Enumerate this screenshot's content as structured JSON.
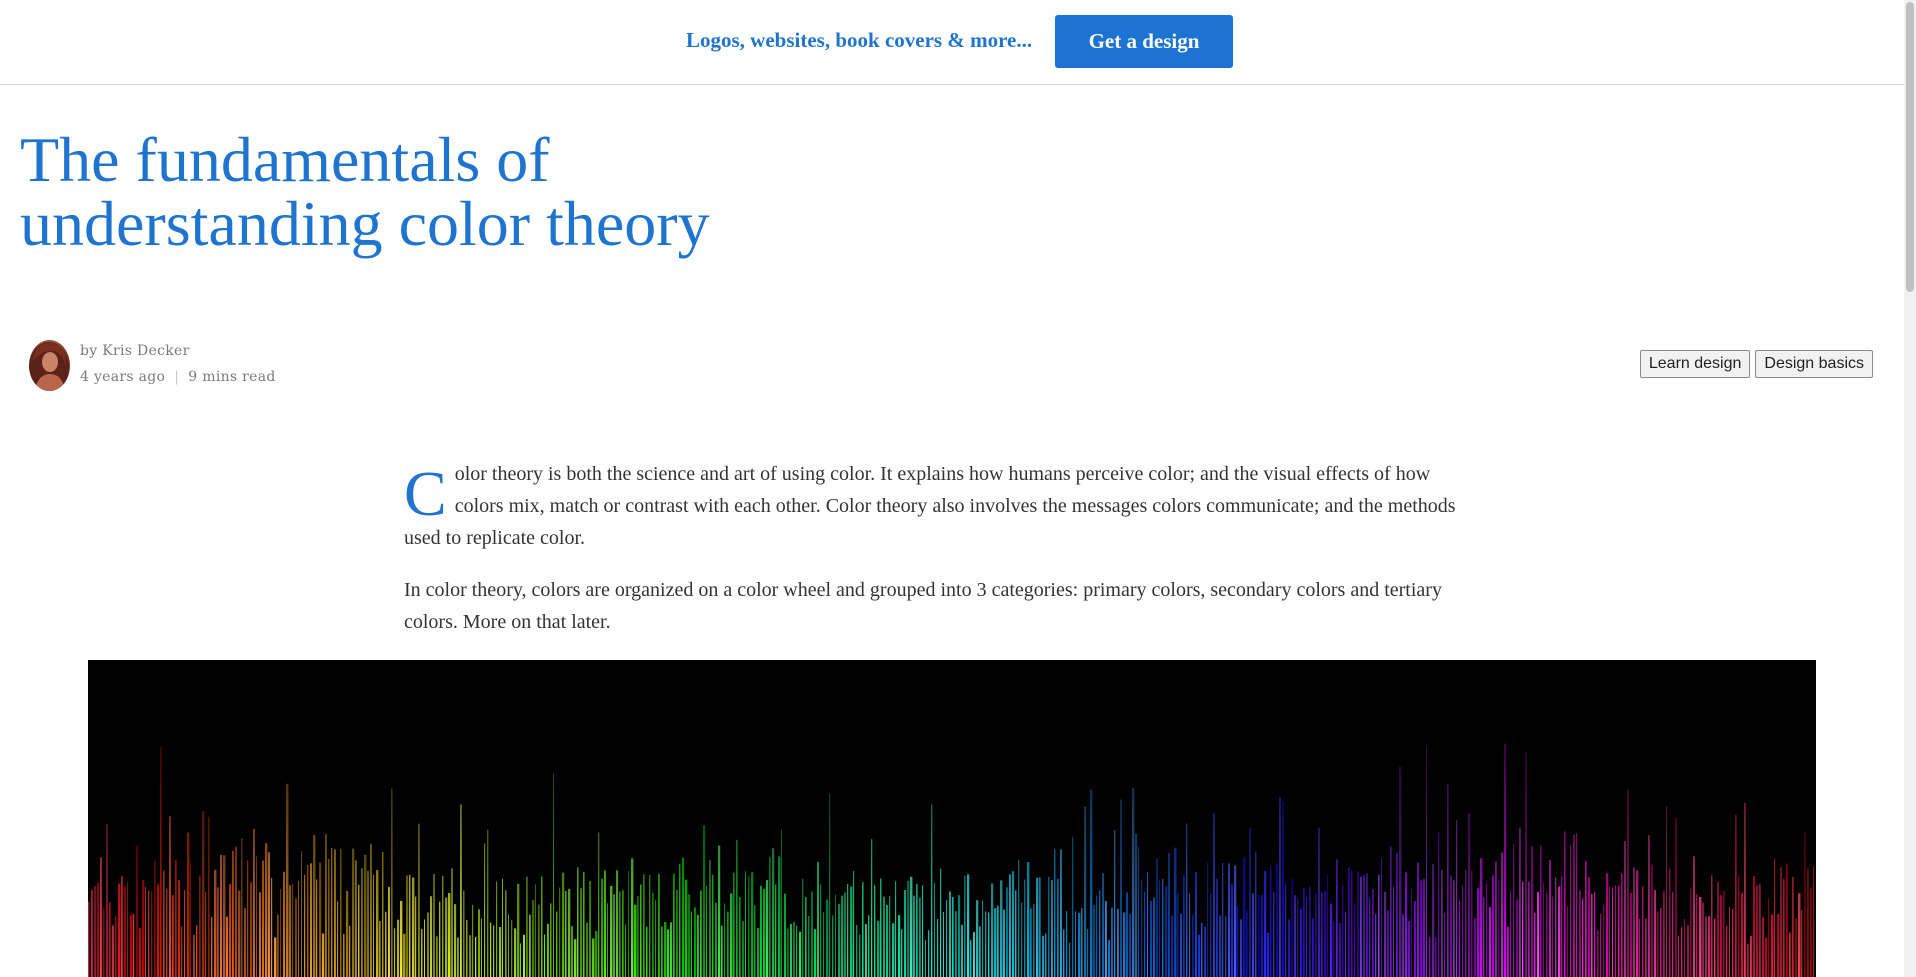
{
  "banner": {
    "tagline": "Logos, websites, book covers & more...",
    "cta_label": "Get a design",
    "accent_color": "#1c73d1"
  },
  "article": {
    "title": "The fundamentals of understanding color theory",
    "author": {
      "by_line": "by Kris Decker",
      "posted": "4 years ago",
      "separator": "|",
      "read_time": "9 mins read"
    },
    "tags": [
      "Learn design",
      "Design basics"
    ],
    "paragraphs": [
      {
        "drop_cap": "C",
        "text": "olor theory is both the science and art of using color. It explains how humans perceive color; and the visual effects of how colors mix, match or contrast with each other. Color theory also involves the messages colors communicate; and the methods used to replicate color."
      },
      {
        "text": "In color theory, colors are organized on a color wheel and grouped into 3 categories: primary colors, secondary colors and tertiary colors. More on that later."
      }
    ],
    "hero_image": {
      "subject": "rainbow spectrum light bars on black background",
      "background_color": "#000000"
    }
  }
}
